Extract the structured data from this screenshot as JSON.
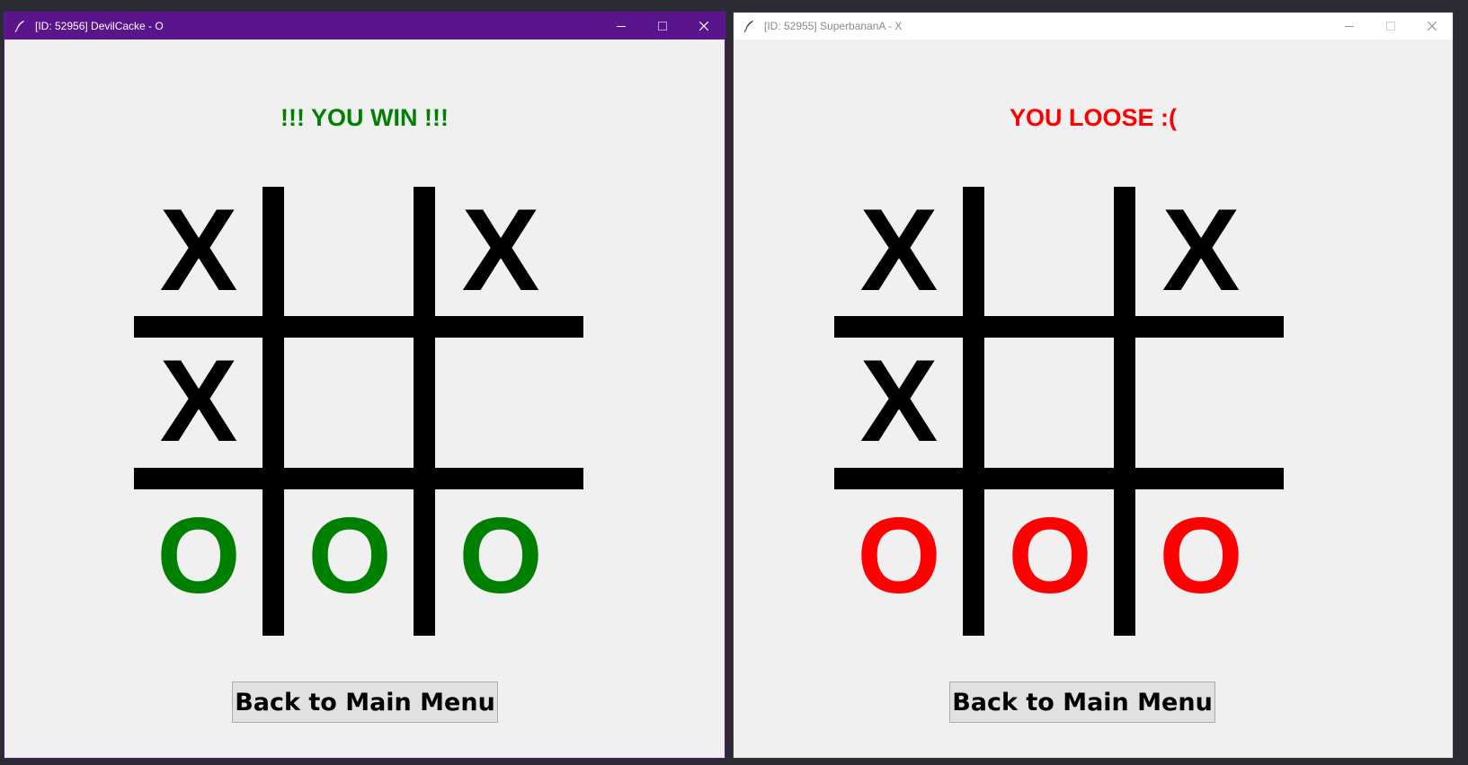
{
  "colors": {
    "win": "#008000",
    "lose": "#ff0000",
    "x": "#000000",
    "active_titlebar": "#5b158c",
    "desktop": "#2a2b33"
  },
  "icons": {
    "app": "feather-icon",
    "minimize": "minimize-icon",
    "maximize": "maximize-icon",
    "close": "close-icon"
  },
  "windows": [
    {
      "title": "[ID: 52956] DevilCacke - O",
      "status": "!!! YOU WIN !!!",
      "status_color": "#008000",
      "o_color": "#008000",
      "board": [
        [
          "X",
          "",
          "X"
        ],
        [
          "X",
          "",
          ""
        ],
        [
          "O",
          "O",
          "O"
        ]
      ],
      "button_label": "Back to Main Menu"
    },
    {
      "title": "[ID: 52955] SuperbananA - X",
      "status": "YOU LOOSE :(",
      "status_color": "#ff0000",
      "o_color": "#ff0000",
      "board": [
        [
          "X",
          "",
          "X"
        ],
        [
          "X",
          "",
          ""
        ],
        [
          "O",
          "O",
          "O"
        ]
      ],
      "button_label": "Back to Main Menu"
    }
  ]
}
